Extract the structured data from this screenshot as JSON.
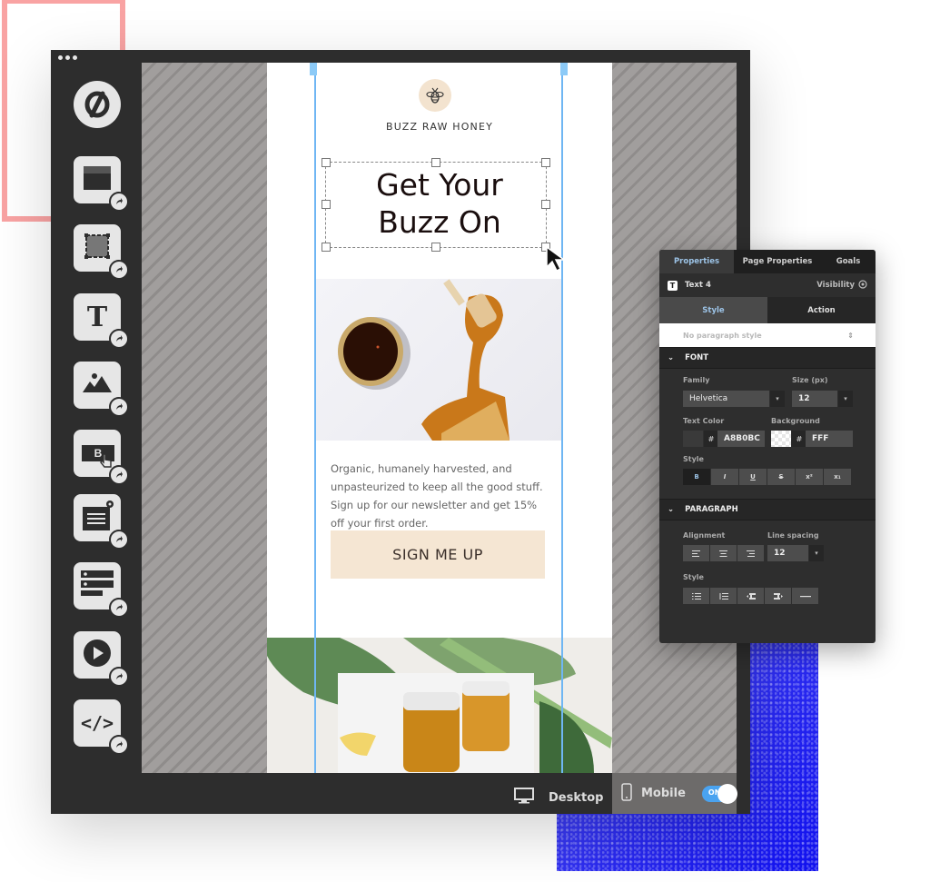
{
  "window": {
    "menu_dots_icon": "more-horizontal-icon"
  },
  "sidebar": {
    "logo_icon": "unbounce-logo-icon",
    "tools": [
      {
        "name": "section",
        "icon": "section-block-icon"
      },
      {
        "name": "box",
        "icon": "box-dashed-icon"
      },
      {
        "name": "text",
        "icon": "text-t-icon",
        "glyph": "T"
      },
      {
        "name": "image",
        "icon": "image-mountain-icon"
      },
      {
        "name": "button",
        "icon": "button-click-icon",
        "glyph": "B"
      },
      {
        "name": "form",
        "icon": "form-lightbox-icon"
      },
      {
        "name": "list",
        "icon": "list-rows-icon"
      },
      {
        "name": "video",
        "icon": "video-play-icon"
      },
      {
        "name": "custom-html",
        "icon": "code-icon",
        "glyph": "</>"
      }
    ]
  },
  "page": {
    "brand": "BUZZ RAW HONEY",
    "headline_line1": "Get Your",
    "headline_line2": "Buzz On",
    "body": "Organic, humanely harvested, and unpasteurized to keep all the good stuff. Sign up for our newsletter and get 15% off your first order.",
    "cta": "SIGN ME UP",
    "cta_color": "#F5E6D3",
    "bee_bg": "#F3E3CF"
  },
  "bottombar": {
    "desktop_label": "Desktop",
    "mobile_label": "Mobile",
    "toggle_label": "ON",
    "toggle_on": true
  },
  "panel": {
    "tabs": [
      "Properties",
      "Page Properties",
      "Goals"
    ],
    "active_tab": "Properties",
    "element_name": "Text 4",
    "element_glyph": "T",
    "visibility_label": "Visibility",
    "subtabs": [
      "Style",
      "Action"
    ],
    "paragraph_style": "No paragraph style",
    "font_section": "FONT",
    "family_label": "Family",
    "family_value": "Helvetica",
    "size_label": "Size (px)",
    "size_value": "12",
    "text_color_label": "Text Color",
    "text_color_value": "A8B0BC",
    "background_label": "Background",
    "background_value": "FFF",
    "hash": "#",
    "style_label": "Style",
    "style_buttons": [
      "B",
      "I",
      "U",
      "S",
      "x²",
      "x₁"
    ],
    "paragraph_section": "PARAGRAPH",
    "alignment_label": "Alignment",
    "line_spacing_label": "Line spacing",
    "line_spacing_value": "12",
    "para_style_label": "Style",
    "para_style_buttons": [
      "bulleted-list-icon",
      "numbered-list-icon",
      "outdent-icon",
      "indent-icon",
      "horizontal-rule-icon"
    ]
  }
}
